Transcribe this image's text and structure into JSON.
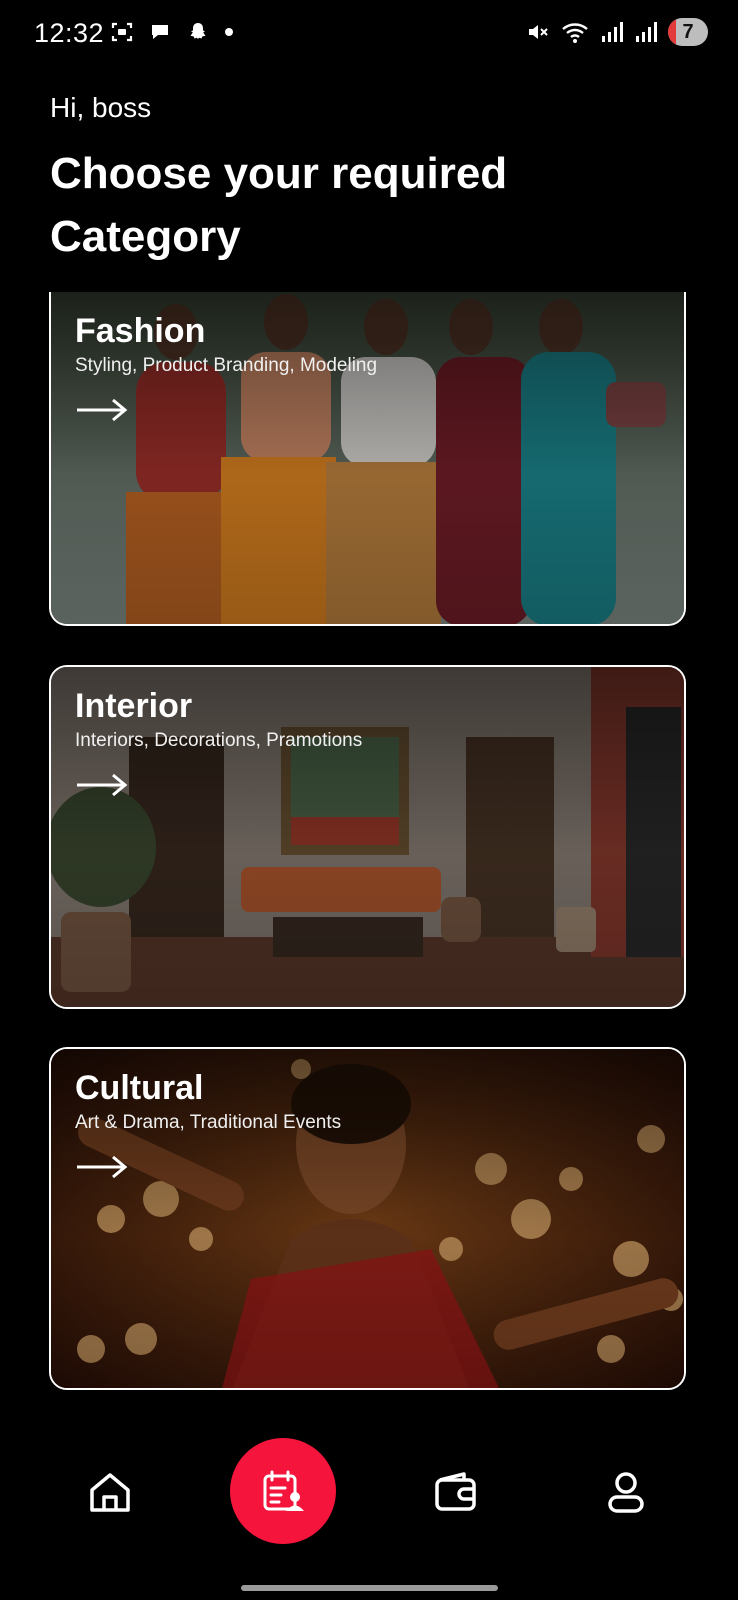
{
  "status_bar": {
    "time": "12:32",
    "left_icons": [
      "screenshot-icon",
      "chat-bubble-icon",
      "snapchat-icon",
      "dot-icon"
    ],
    "right_icons": [
      "mute-icon",
      "wifi-icon",
      "signal-icon",
      "signal-icon"
    ],
    "battery": "7"
  },
  "header": {
    "greeting": "Hi, boss",
    "headline": "Choose your required Category"
  },
  "categories": [
    {
      "title": "Fashion",
      "subtitle": "Styling, Product Branding, Modeling"
    },
    {
      "title": "Interior",
      "subtitle": "Interiors, Decorations, Pramotions"
    },
    {
      "title": "Cultural",
      "subtitle": "Art & Drama, Traditional Events"
    }
  ],
  "bottom_nav": {
    "items": [
      "home-icon",
      "bookings-icon",
      "wallet-icon",
      "profile-icon"
    ],
    "active": "bookings-icon",
    "accent_color": "#f5143c"
  }
}
